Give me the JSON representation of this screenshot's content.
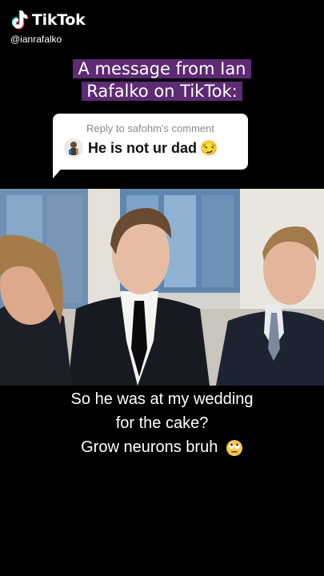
{
  "watermark": {
    "app_name": "TikTok",
    "handle": "@ianrafalko",
    "logo_icon": "tiktok-logo-icon"
  },
  "headline": {
    "line1": "A message from Ian",
    "line2": "Rafalko on TikTok:"
  },
  "reply_bubble": {
    "reply_label": "Reply to safohm's comment",
    "comment_text": "He is not ur dad",
    "emoji": "😏",
    "avatar_icon": "commenter-avatar-icon"
  },
  "video": {
    "scene": "video-frame"
  },
  "caption": {
    "line1": "So he was at my wedding",
    "line2": "for the cake?",
    "line3": "Grow neurons bruh",
    "emoji_icon": "eye-roll-emoji-icon"
  },
  "colors": {
    "headline_bg": "#5e2a74",
    "background": "#000000",
    "bubble_bg": "#ffffff",
    "reply_gray": "#8a8a8a"
  }
}
